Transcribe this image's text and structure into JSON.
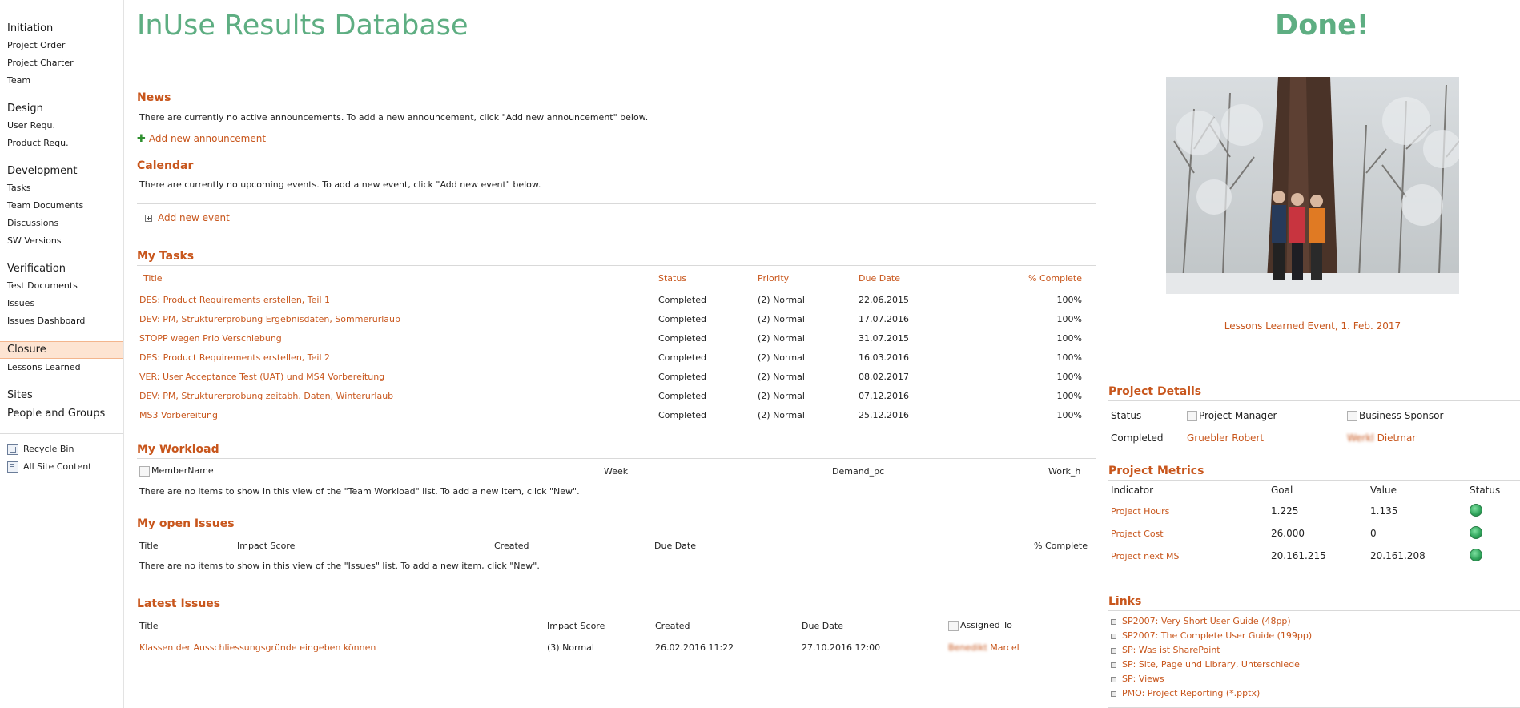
{
  "nav": {
    "groups": [
      {
        "head": "Initiation",
        "items": [
          "Project Order",
          "Project Charter",
          "Team"
        ]
      },
      {
        "head": "Design",
        "items": [
          "User Requ.",
          "Product Requ."
        ]
      },
      {
        "head": "Development",
        "items": [
          "Tasks",
          "Team Documents",
          "Discussions",
          "SW Versions"
        ]
      },
      {
        "head": "Verification",
        "items": [
          "Test Documents",
          "Issues",
          "Issues Dashboard"
        ]
      },
      {
        "head": "Closure",
        "items": [
          "Lessons Learned"
        ]
      },
      {
        "head": "Sites",
        "items": []
      },
      {
        "head": "People and Groups",
        "items": []
      }
    ],
    "recycle_bin": "Recycle Bin",
    "all_site_content": "All Site Content"
  },
  "site_title": "InUse Results Database",
  "news": {
    "title": "News",
    "message": "There are currently no active announcements. To add a new announcement, click \"Add new announcement\" below.",
    "add_link": "Add new announcement"
  },
  "calendar": {
    "title": "Calendar",
    "message": "There are currently no upcoming events. To add a new event, click \"Add new event\" below.",
    "add_link": "Add new event"
  },
  "my_tasks": {
    "title": "My Tasks",
    "headers": {
      "title": "Title",
      "status": "Status",
      "priority": "Priority",
      "due": "Due Date",
      "complete": "% Complete"
    },
    "rows": [
      {
        "title": "DES: Product Requirements erstellen, Teil 1",
        "status": "Completed",
        "priority": "(2) Normal",
        "due": "22.06.2015",
        "complete": "100%"
      },
      {
        "title": "DEV: PM, Strukturerprobung Ergebnisdaten, Sommerurlaub",
        "status": "Completed",
        "priority": "(2) Normal",
        "due": "17.07.2016",
        "complete": "100%"
      },
      {
        "title": "STOPP wegen Prio Verschiebung",
        "status": "Completed",
        "priority": "(2) Normal",
        "due": "31.07.2015",
        "complete": "100%"
      },
      {
        "title": "DES: Product Requirements erstellen, Teil 2",
        "status": "Completed",
        "priority": "(2) Normal",
        "due": "16.03.2016",
        "complete": "100%"
      },
      {
        "title": "VER: User Acceptance Test (UAT) und MS4 Vorbereitung",
        "status": "Completed",
        "priority": "(2) Normal",
        "due": "08.02.2017",
        "complete": "100%"
      },
      {
        "title": "DEV: PM, Strukturerprobung zeitabh. Daten, Winterurlaub",
        "status": "Completed",
        "priority": "(2) Normal",
        "due": "07.12.2016",
        "complete": "100%"
      },
      {
        "title": "MS3 Vorbereitung",
        "status": "Completed",
        "priority": "(2) Normal",
        "due": "25.12.2016",
        "complete": "100%"
      }
    ]
  },
  "my_workload": {
    "title": "My Workload",
    "headers": {
      "member": "MemberName",
      "week": "Week",
      "demand": "Demand_pc",
      "work": "Work_h"
    },
    "message": "There are no items to show in this view of the \"Team Workload\" list. To add a new item, click \"New\"."
  },
  "open_issues": {
    "title": "My open Issues",
    "headers": {
      "title": "Title",
      "impact": "Impact Score",
      "created": "Created",
      "due": "Due Date",
      "complete": "% Complete"
    },
    "message": "There are no items to show in this view of the \"Issues\" list. To add a new item, click \"New\"."
  },
  "latest_issues": {
    "title": "Latest Issues",
    "headers": {
      "title": "Title",
      "impact": "Impact Score",
      "created": "Created",
      "due": "Due Date",
      "assigned": "Assigned To"
    },
    "rows": [
      {
        "title": "Klassen der Ausschliessungsgründe eingeben können",
        "impact": "(3) Normal",
        "created": "26.02.2016 11:22",
        "due": "27.10.2016 12:00",
        "assigned_blurred": "Benedikt",
        "assigned": "Marcel"
      }
    ]
  },
  "right": {
    "done_title": "Done!",
    "photo_caption": "Lessons Learned Event, 1. Feb. 2017",
    "project_details": {
      "title": "Project Details",
      "status_label": "Status",
      "status_value": "Completed",
      "pm_label": "Project Manager",
      "pm_value": "Gruebler Robert",
      "sponsor_label": "Business Sponsor",
      "sponsor_blurred": "Werkl",
      "sponsor_value": "Dietmar"
    },
    "project_metrics": {
      "title": "Project Metrics",
      "headers": {
        "indicator": "Indicator",
        "goal": "Goal",
        "value": "Value",
        "status": "Status"
      },
      "rows": [
        {
          "indicator": "Project Hours",
          "goal": "1.225",
          "value": "1.135",
          "status": "green"
        },
        {
          "indicator": "Project Cost",
          "goal": "26.000",
          "value": "0",
          "status": "green"
        },
        {
          "indicator": "Project next MS",
          "goal": "20.161.215",
          "value": "20.161.208",
          "status": "green"
        }
      ]
    },
    "links": {
      "title": "Links",
      "items": [
        "SP2007: Very Short User Guide (48pp)",
        "SP2007: The Complete User Guide (199pp)",
        "SP: Was ist SharePoint",
        "SP: Site, Page und Library, Unterschiede",
        "SP: Views",
        "PMO: Project Reporting (*.pptx)"
      ]
    }
  },
  "colors": {
    "accent": "#c8561c",
    "title_green": "#5eae82",
    "active_nav": "#fde4d2",
    "status_green": "#2ea35a"
  }
}
